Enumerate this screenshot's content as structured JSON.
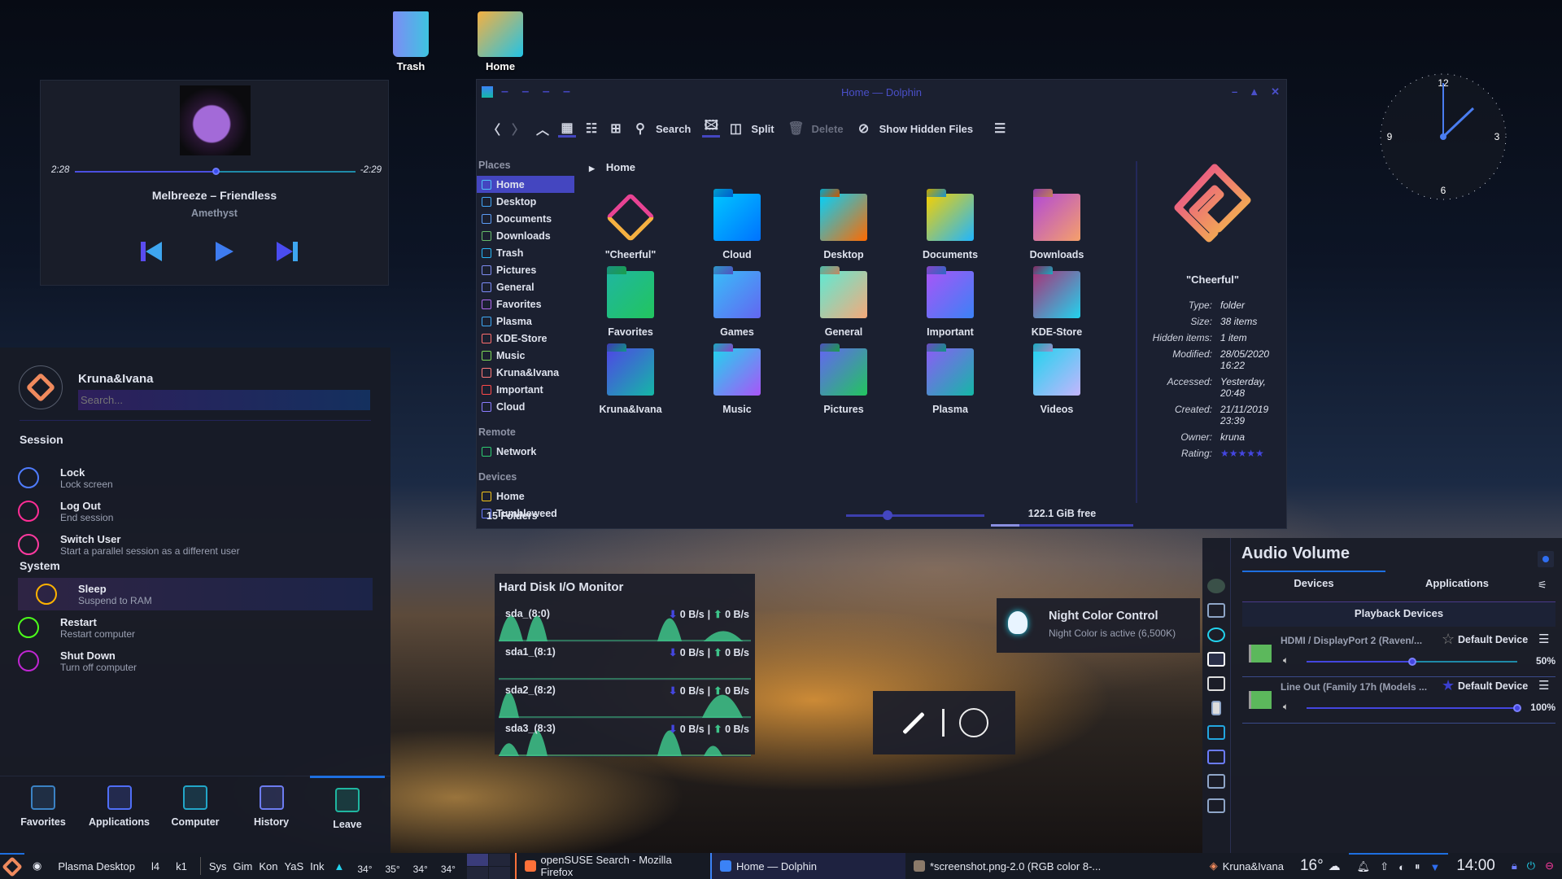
{
  "desktop": {
    "icons": [
      {
        "label": "Trash"
      },
      {
        "label": "Home"
      }
    ]
  },
  "media": {
    "elapsed": "2:28",
    "remaining": "-2:29",
    "progress": 0.5,
    "title": "Melbreeze – Friendless",
    "artist": "Amethyst"
  },
  "clock": {
    "dial": [
      "12",
      "3",
      "6",
      "9"
    ],
    "time": "14:00"
  },
  "dolphin": {
    "title": "Home — Dolphin",
    "toolbar": {
      "search": "Search",
      "split": "Split",
      "delete": "Delete",
      "hidden": "Show Hidden Files"
    },
    "breadcrumb": "Home",
    "places_header": "Places",
    "places": [
      {
        "label": "Home",
        "color": "#4fc3f7"
      },
      {
        "label": "Desktop",
        "color": "#42a5f5"
      },
      {
        "label": "Documents",
        "color": "#5c9cf5"
      },
      {
        "label": "Downloads",
        "color": "#66bb6a"
      },
      {
        "label": "Trash",
        "color": "#29b6f6"
      },
      {
        "label": "Pictures",
        "color": "#7e8cf0"
      },
      {
        "label": "General",
        "color": "#7c8cf8"
      },
      {
        "label": "Favorites",
        "color": "#b06af0"
      },
      {
        "label": "Plasma",
        "color": "#3fa9f5"
      },
      {
        "label": "KDE-Store",
        "color": "#ff6e6e"
      },
      {
        "label": "Music",
        "color": "#7ed957"
      },
      {
        "label": "Kruna&Ivana",
        "color": "#ff7a7a"
      },
      {
        "label": "Important",
        "color": "#ff4a4a"
      },
      {
        "label": "Cloud",
        "color": "#8a7cff"
      }
    ],
    "remote_header": "Remote",
    "remote": [
      {
        "label": "Network",
        "color": "#2ecc71"
      }
    ],
    "devices_header": "Devices",
    "devices": [
      {
        "label": "Home",
        "color": "#f5c518"
      },
      {
        "label": "Tumbleweed",
        "color": "#6b7cff"
      }
    ],
    "folders": [
      {
        "label": "\"Cheerful\"",
        "c1": "#e84393",
        "c2": "#f5b041",
        "logo": true
      },
      {
        "label": "Cloud",
        "c1": "#00c6ff",
        "c2": "#0072ff"
      },
      {
        "label": "Desktop",
        "c1": "#00d2ff",
        "c2": "#ff6a00"
      },
      {
        "label": "Documents",
        "c1": "#f7d000",
        "c2": "#1fb6ff"
      },
      {
        "label": "Downloads",
        "c1": "#b24ad6",
        "c2": "#f5a06a"
      },
      {
        "label": "Favorites",
        "c1": "#1fb6a0",
        "c2": "#22c55e"
      },
      {
        "label": "Games",
        "c1": "#38bdf8",
        "c2": "#6366f1"
      },
      {
        "label": "General",
        "c1": "#5eead4",
        "c2": "#f5a97a"
      },
      {
        "label": "Important",
        "c1": "#a855f7",
        "c2": "#3b82f6"
      },
      {
        "label": "KDE-Store",
        "c1": "#a83279",
        "c2": "#22d3ee"
      },
      {
        "label": "Kruna&Ivana",
        "c1": "#4f46e5",
        "c2": "#14b8a6"
      },
      {
        "label": "Music",
        "c1": "#22d3ee",
        "c2": "#a855f7"
      },
      {
        "label": "Pictures",
        "c1": "#6366f1",
        "c2": "#22c55e"
      },
      {
        "label": "Plasma",
        "c1": "#8b5cf6",
        "c2": "#14b8a6"
      },
      {
        "label": "Videos",
        "c1": "#22d3ee",
        "c2": "#c4b5fd"
      }
    ],
    "status": "15 Folders",
    "zoom": 0.3,
    "free": "122.1 GiB free",
    "used_fraction": 0.2,
    "info": {
      "name": "\"Cheerful\"",
      "rows": [
        {
          "k": "Type:",
          "v": "folder"
        },
        {
          "k": "Size:",
          "v": "38 items"
        },
        {
          "k": "Hidden items:",
          "v": "1 item"
        },
        {
          "k": "Modified:",
          "v": "28/05/2020 16:22"
        },
        {
          "k": "Accessed:",
          "v": "Yesterday, 20:48"
        },
        {
          "k": "Created:",
          "v": "21/11/2019 23:39"
        },
        {
          "k": "Owner:",
          "v": "kruna"
        }
      ],
      "rating_label": "Rating:",
      "rating": 5
    }
  },
  "leave": {
    "user": "Kruna&Ivana",
    "search_placeholder": "Search...",
    "session_header": "Session",
    "system_header": "System",
    "session": [
      {
        "title": "Lock",
        "sub": "Lock screen",
        "color": "#4f7cff"
      },
      {
        "title": "Log Out",
        "sub": "End session",
        "color": "#ff2d95"
      },
      {
        "title": "Switch User",
        "sub": "Start a parallel session as a different user",
        "color": "#ff3aa0"
      }
    ],
    "system": [
      {
        "title": "Sleep",
        "sub": "Suspend to RAM",
        "color": "#ffb300",
        "active": true
      },
      {
        "title": "Restart",
        "sub": "Restart computer",
        "color": "#4cff1a"
      },
      {
        "title": "Shut Down",
        "sub": "Turn off computer",
        "color": "#c026d3"
      }
    ],
    "tabs": [
      {
        "label": "Favorites",
        "color": "#3b82c4"
      },
      {
        "label": "Applications",
        "color": "#4f6ef7"
      },
      {
        "label": "Computer",
        "color": "#22a6c8"
      },
      {
        "label": "History",
        "color": "#6d7cf0"
      },
      {
        "label": "Leave",
        "color": "#1fb6a0",
        "active": true
      }
    ]
  },
  "disk": {
    "title": "Hard Disk I/O Monitor",
    "rows": [
      {
        "name": "sda_(8:0)",
        "read": "0 B/s",
        "write": "0 B/s"
      },
      {
        "name": "sda1_(8:1)",
        "read": "0 B/s",
        "write": "0 B/s"
      },
      {
        "name": "sda2_(8:2)",
        "read": "0 B/s",
        "write": "0 B/s"
      },
      {
        "name": "sda3_(8:3)",
        "read": "0 B/s",
        "write": "0 B/s"
      }
    ],
    "separator": "|"
  },
  "night": {
    "title": "Night Color Control",
    "subtitle": "Night Color is active (6,500K)"
  },
  "audio": {
    "title": "Audio Volume",
    "tabs": [
      "Devices",
      "Applications"
    ],
    "section": "Playback Devices",
    "devices": [
      {
        "name": "HDMI / DisplayPort 2 (Raven/...",
        "default_label": "Default Device",
        "is_default": false,
        "volume": 50,
        "volume_text": "50%"
      },
      {
        "name": "Line Out (Family 17h (Models ...",
        "default_label": "Default Device",
        "is_default": true,
        "volume": 100,
        "volume_text": "100%"
      }
    ]
  },
  "taskbar": {
    "activity": "Plasma Desktop",
    "launchers": [
      "l4",
      "k1"
    ],
    "quick": [
      "Sys",
      "Gim",
      "Kon",
      "YaS",
      "Ink"
    ],
    "temps": [
      "34°",
      "35°",
      "34°",
      "34°"
    ],
    "tasks": [
      {
        "label": "openSUSE Search - Mozilla Firefox",
        "color": "#ff7139"
      },
      {
        "label": "Home — Dolphin",
        "color": "#3b82f6",
        "active": true
      },
      {
        "label": "*screenshot.png-2.0 (RGB color 8-...",
        "color": "#8b7a6a"
      }
    ],
    "user": "Kruna&Ivana",
    "weather": "16°",
    "clock": "14:00"
  },
  "colors": {
    "accent": "#4446c0",
    "accent_blue": "#1e6fe0",
    "teal": "#3ec48a"
  }
}
